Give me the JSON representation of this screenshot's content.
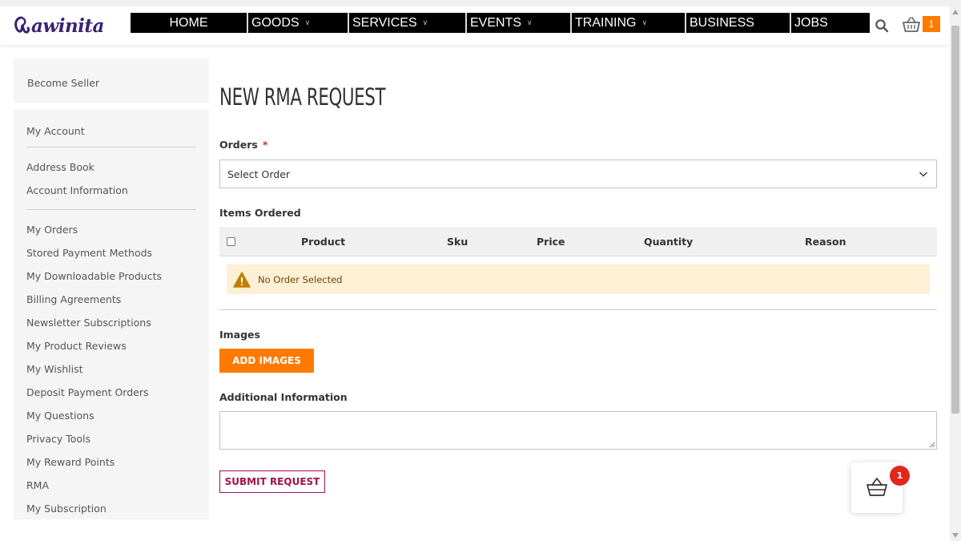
{
  "header": {
    "logo_text": "awinita",
    "nav": [
      {
        "label": "HOME",
        "has_dropdown": false
      },
      {
        "label": "GOODS",
        "has_dropdown": true
      },
      {
        "label": "SERVICES",
        "has_dropdown": true
      },
      {
        "label": "EVENTS",
        "has_dropdown": true
      },
      {
        "label": "TRAINING",
        "has_dropdown": true
      },
      {
        "label": "BUSINESS",
        "has_dropdown": false
      },
      {
        "label": "JOBS",
        "has_dropdown": false
      }
    ],
    "cart_count": "1"
  },
  "sidebar": {
    "become_seller": "Become Seller",
    "groups": [
      [
        "My Account"
      ],
      [
        "Address Book",
        "Account Information"
      ],
      [
        "My Orders",
        "Stored Payment Methods",
        "My Downloadable Products",
        "Billing Agreements",
        "Newsletter Subscriptions",
        "My Product Reviews",
        "My Wishlist",
        "Deposit Payment Orders",
        "My Questions",
        "Privacy Tools",
        "My Reward Points",
        "RMA",
        "My Subscription"
      ]
    ]
  },
  "main": {
    "title": "NEW RMA REQUEST",
    "orders_label": "Orders",
    "required_mark": "*",
    "orders_select_value": "Select Order",
    "items_label": "Items Ordered",
    "table_headers": {
      "product": "Product",
      "sku": "Sku",
      "price": "Price",
      "quantity": "Quantity",
      "reason": "Reason"
    },
    "notice": "No Order Selected",
    "images_label": "Images",
    "add_images_button": "ADD IMAGES",
    "additional_info_label": "Additional Information",
    "additional_info_value": "",
    "submit_button": "SUBMIT REQUEST"
  },
  "floating_cart": {
    "count": "1"
  },
  "colors": {
    "brand_purple": "#3b2374",
    "accent_orange": "#ff7a00",
    "submit_magenta": "#a0124d",
    "badge_red": "#e3261b",
    "notice_bg": "#fdf0d5"
  }
}
